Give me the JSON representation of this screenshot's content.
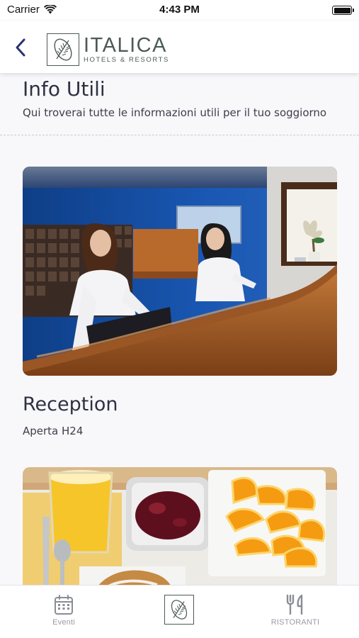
{
  "status_bar": {
    "carrier": "Carrier",
    "time": "4:43 PM",
    "battery_level": 1.0
  },
  "header": {
    "logo_name": "ITALICA",
    "logo_subtitle": "HOTELS & RESORTS",
    "back_icon": "chevron-left-icon"
  },
  "page": {
    "title": "Info Utili",
    "subtitle": "Qui troverai tutte le informazioni utili per il tuo soggiorno"
  },
  "cards": [
    {
      "image": "reception-photo",
      "title": "Reception",
      "text": "Aperta H24"
    },
    {
      "image": "breakfast-photo"
    }
  ],
  "tab_bar": {
    "items": [
      {
        "label": "Eventi",
        "icon": "calendar-icon"
      },
      {
        "label": "",
        "icon": "italica-logo-icon"
      },
      {
        "label": "RISTORANTI",
        "icon": "fork-knife-icon"
      }
    ]
  },
  "colors": {
    "brand": "#4c5a55",
    "text": "#2f3142",
    "tab_inactive": "#9a9ba5",
    "back_arrow": "#2b3270"
  }
}
